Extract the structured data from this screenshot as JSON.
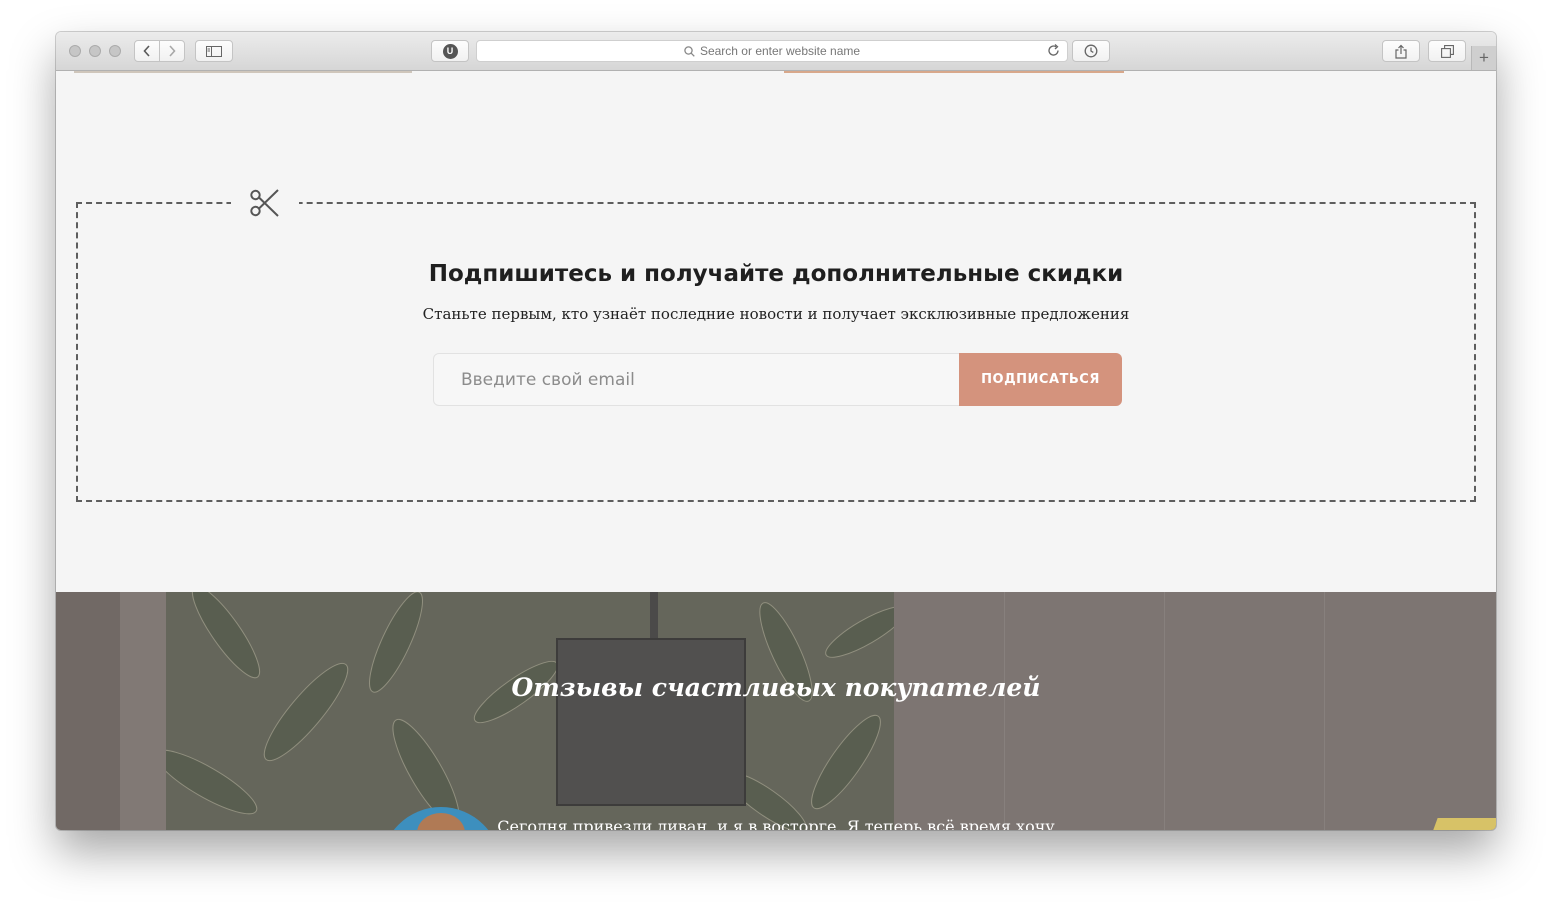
{
  "browser": {
    "address_placeholder": "Search or enter website name",
    "extension_badge": "U",
    "new_tab_label": "+"
  },
  "subscribe": {
    "title": "Подпишитесь и получайте дополнительные скидки",
    "description": "Станьте первым, кто узнаёт последние новости и получает эксклюзивные предложения",
    "email_placeholder": "Введите свой email",
    "button_label": "ПОДПИСАТЬСЯ"
  },
  "reviews": {
    "title": "Отзывы счастливых покупателей",
    "first_review_text": "Сегодня привезли диван, и я в восторге. Я теперь всё время хочу"
  },
  "colors": {
    "accent": "#d4937d",
    "page_background": "#f5f5f5"
  }
}
